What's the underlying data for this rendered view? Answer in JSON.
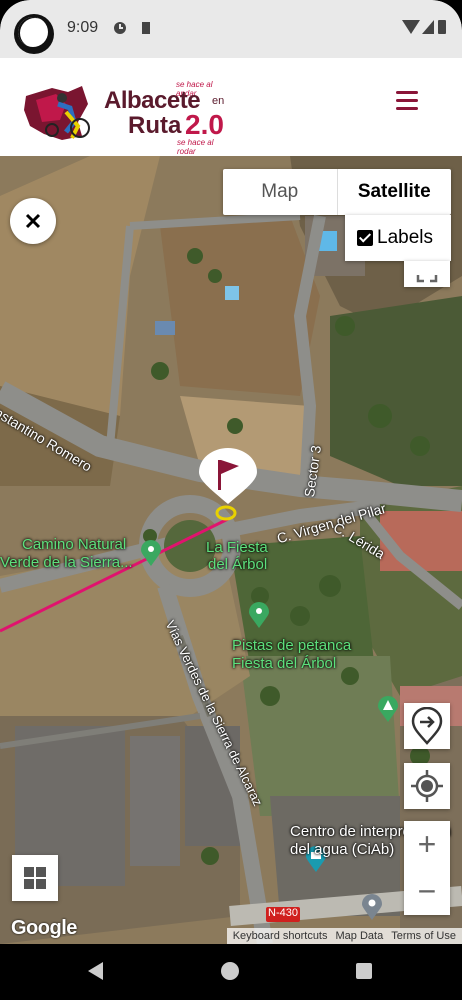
{
  "status_bar": {
    "time": "9:09"
  },
  "header": {
    "logo": {
      "top_tagline": "se hace al andar",
      "word_city": "Albacete",
      "word_en": "en",
      "word_ruta": "Ruta",
      "word_version": "2.0",
      "bottom_tagline": "se hace al rodar"
    },
    "menu_icon": "hamburger-menu-icon"
  },
  "map": {
    "map_type": {
      "options": [
        "Map",
        "Satellite"
      ],
      "selected": "Satellite"
    },
    "labels_toggle": {
      "label": "Labels",
      "checked": true
    },
    "place_labels": {
      "road_constantino": "nstantino Romero",
      "road_sector3": "Sector 3",
      "road_virgen": "C. Virgen del Pilar",
      "road_lerida": "C. Lérida",
      "camino_1": "Camino Natural",
      "camino_2": "Verde de la Sierra...",
      "fiesta_1": "La Fiesta",
      "fiesta_2": "del Árbol",
      "pistas_1": "Pistas de petanca",
      "pistas_2": "Fiesta del Árbol",
      "vias_verdes": "Vías Verdes de la Sierra de Alcaraz",
      "centro_1": "Centro de interpretación",
      "centro_2": "del agua (CiAb)",
      "road_n430": "N-430"
    },
    "zoom": {
      "in": "+",
      "out": "−"
    },
    "brand": "Google",
    "attribution": [
      "Keyboard shortcuts",
      "Map Data",
      "Terms of Use"
    ],
    "colors": {
      "route": "#e0136e",
      "flag": "#8a1538",
      "poi_green": "#3aa860"
    }
  }
}
